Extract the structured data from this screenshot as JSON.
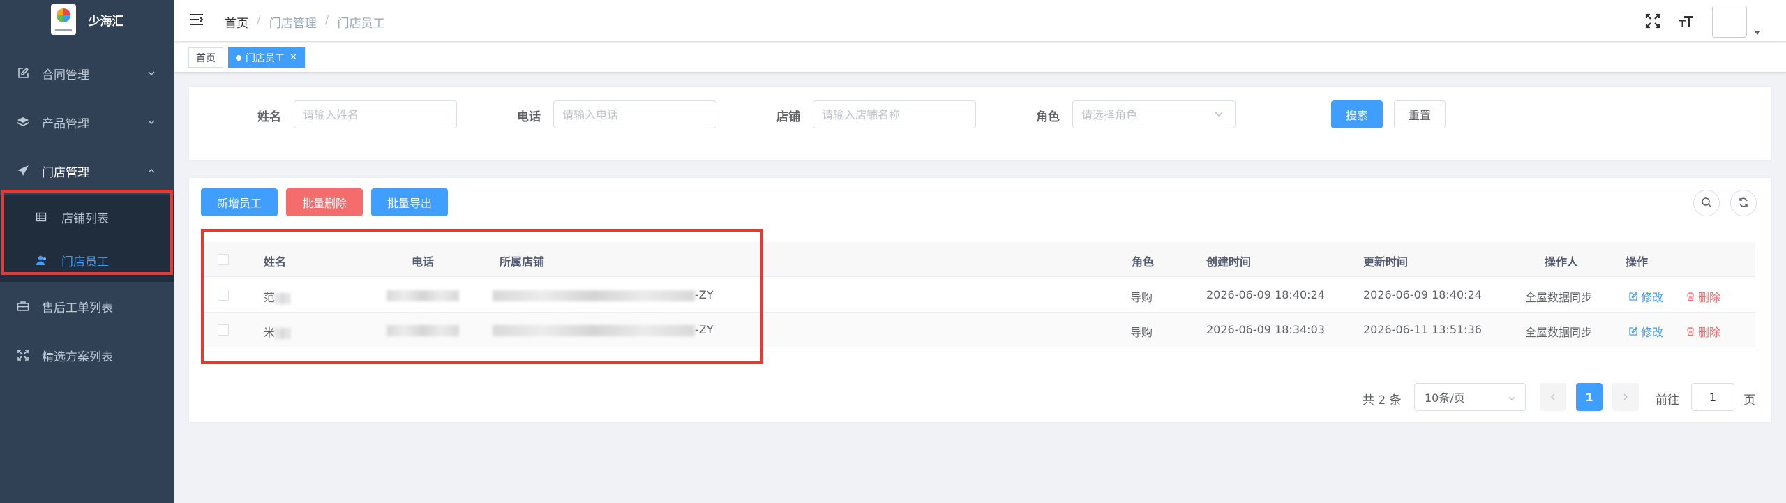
{
  "app": {
    "brand": "少海汇"
  },
  "sidebar": {
    "items": [
      {
        "label": "合同管理",
        "icon": "edit-icon"
      },
      {
        "label": "产品管理",
        "icon": "layers-icon"
      },
      {
        "label": "门店管理",
        "icon": "send-icon",
        "expanded": true,
        "children": [
          {
            "label": "店铺列表",
            "icon": "table-icon"
          },
          {
            "label": "门店员工",
            "icon": "user-icon",
            "active": true
          }
        ]
      },
      {
        "label": "售后工单列表",
        "icon": "briefcase-icon"
      },
      {
        "label": "精选方案列表",
        "icon": "fullscreen-icon"
      }
    ]
  },
  "breadcrumb": {
    "home": "首页",
    "parent": "门店管理",
    "current": "门店员工",
    "separator": "/"
  },
  "tags": {
    "home": "首页",
    "active": "门店员工"
  },
  "search": {
    "name_label": "姓名",
    "name_placeholder": "请输入姓名",
    "phone_label": "电话",
    "phone_placeholder": "请输入电话",
    "store_label": "店铺",
    "store_placeholder": "请输入店铺名称",
    "role_label": "角色",
    "role_placeholder": "请选择角色",
    "search_button": "搜索",
    "reset_button": "重置"
  },
  "toolbar": {
    "add": "新增员工",
    "batch_delete": "批量删除",
    "batch_export": "批量导出"
  },
  "table": {
    "columns": {
      "name": "姓名",
      "phone": "电话",
      "store": "所属店铺",
      "role": "角色",
      "created": "创建时间",
      "updated": "更新时间",
      "operator": "操作人",
      "actions": "操作"
    },
    "rows": [
      {
        "name_visible": "范",
        "store_suffix": "-ZY",
        "role": "导购",
        "created": "2026-06-09 18:40:24",
        "updated": "2026-06-09 18:40:24",
        "operator": "全屋数据同步"
      },
      {
        "name_visible": "米",
        "store_suffix": "-ZY",
        "role": "导购",
        "created": "2026-06-09 18:34:03",
        "updated": "2026-06-11 13:51:36",
        "operator": "全屋数据同步"
      }
    ],
    "edit_label": "修改",
    "delete_label": "删除"
  },
  "pagination": {
    "total_text": "共 2 条",
    "page_size": "10条/页",
    "current_page": "1",
    "goto_label": "前往",
    "goto_value": "1",
    "page_unit": "页"
  },
  "colors": {
    "primary": "#409eff",
    "danger": "#f56c6c",
    "sidebar": "#304156",
    "highlight": "#e8382f"
  }
}
